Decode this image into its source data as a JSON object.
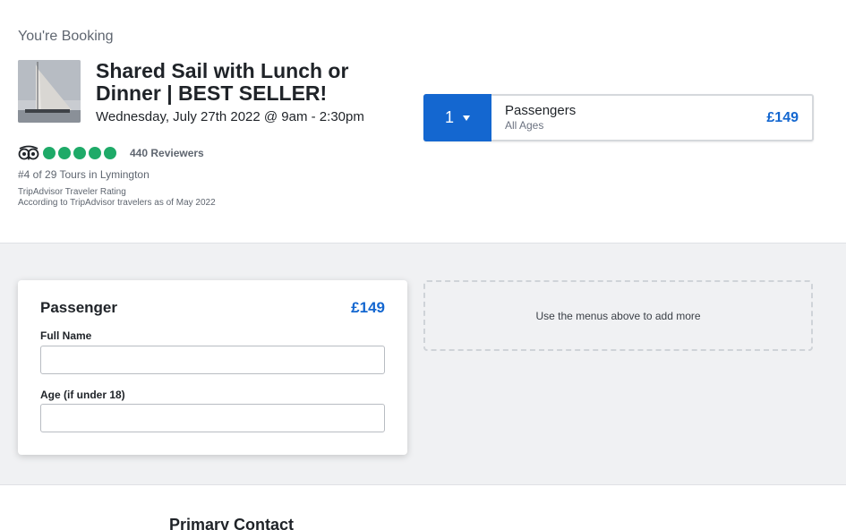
{
  "booking": {
    "label": "You're Booking",
    "title": "Shared Sail with Lunch or Dinner | BEST SELLER!",
    "date": "Wednesday, July 27th 2022 @ 9am - 2:30pm"
  },
  "rating": {
    "bubbles": 5,
    "reviewers": "440 Reviewers",
    "rank": "#4 of 29 Tours in Lymington",
    "source": "TripAdvisor Traveler Rating",
    "note": "According to TripAdvisor travelers as of May 2022",
    "bubble_color": "#1eaa68"
  },
  "passenger_selector": {
    "quantity": "1",
    "label": "Passengers",
    "sublabel": "All Ages",
    "price": "£149",
    "accent_color": "#1467d0"
  },
  "passenger_card": {
    "title": "Passenger",
    "price": "£149",
    "fields": [
      {
        "label": "Full Name",
        "value": ""
      },
      {
        "label": "Age (if under 18)",
        "value": ""
      }
    ]
  },
  "add_more": {
    "text": "Use the menus above to add more"
  },
  "contact": {
    "heading": "Primary Contact"
  },
  "icons": {
    "tripadvisor": "tripadvisor-owl-icon",
    "dropdown": "caret-down-icon"
  }
}
